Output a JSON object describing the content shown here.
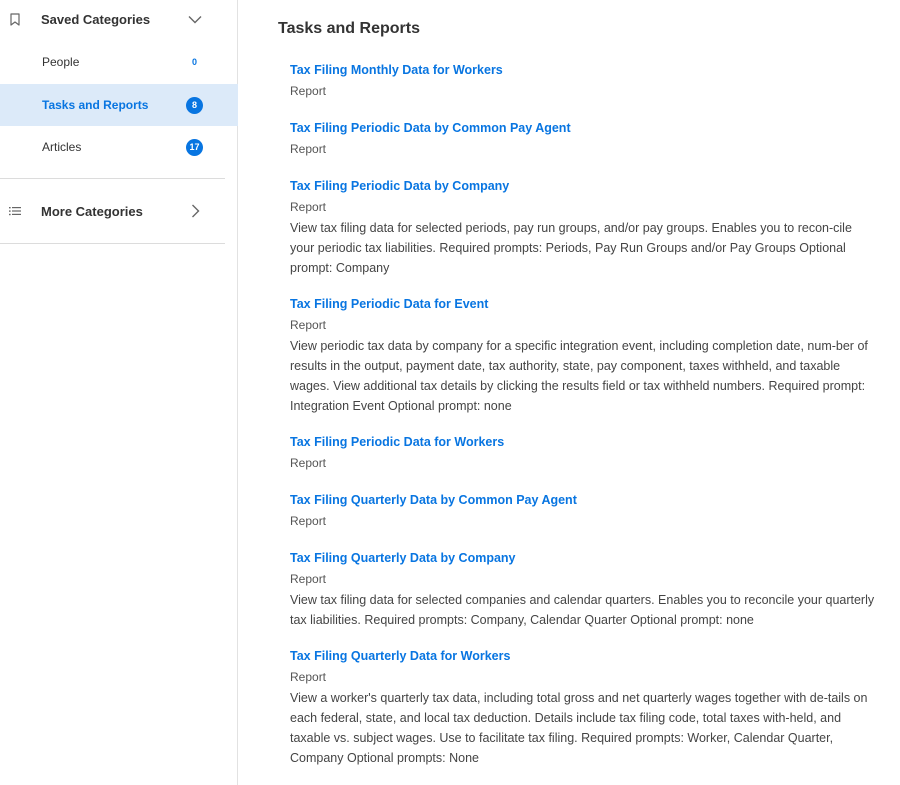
{
  "sidebar": {
    "saved_title": "Saved Categories",
    "saved_icon": "bookmark-icon",
    "saved_toggle_icon": "chevron-down-icon",
    "items": [
      {
        "label": "People",
        "count": "0"
      },
      {
        "label": "Tasks and Reports",
        "count": "8"
      },
      {
        "label": "Articles",
        "count": "17"
      }
    ],
    "more_title": "More Categories",
    "more_icon": "list-icon",
    "more_toggle_icon": "chevron-right-icon"
  },
  "main": {
    "title": "Tasks and Reports",
    "results": [
      {
        "title": "Tax Filing Monthly Data for Workers",
        "type": "Report",
        "desc": ""
      },
      {
        "title": "Tax Filing Periodic Data by Common Pay Agent",
        "type": "Report",
        "desc": ""
      },
      {
        "title": "Tax Filing Periodic Data by Company",
        "type": "Report",
        "desc": "View tax filing data for selected periods, pay run groups, and/or pay groups. Enables you to recon-cile your periodic tax liabilities. Required prompts: Periods, Pay Run Groups and/or Pay Groups Optional prompt: Company"
      },
      {
        "title": "Tax Filing Periodic Data for Event",
        "type": "Report",
        "desc": "View periodic tax data by company for a specific integration event, including completion date, num-ber of results in the output, payment date, tax authority, state, pay component, taxes withheld, and taxable wages. View additional tax details by clicking the results field or tax withheld numbers. Required prompt: Integration Event Optional prompt: none"
      },
      {
        "title": "Tax Filing Periodic Data for Workers",
        "type": "Report",
        "desc": ""
      },
      {
        "title": "Tax Filing Quarterly Data by Common Pay Agent",
        "type": "Report",
        "desc": ""
      },
      {
        "title": "Tax Filing Quarterly Data by Company",
        "type": "Report",
        "desc": "View tax filing data for selected companies and calendar quarters. Enables you to reconcile your quarterly tax liabilities. Required prompts: Company, Calendar Quarter Optional prompt: none"
      },
      {
        "title": "Tax Filing Quarterly Data for Workers",
        "type": "Report",
        "desc": "View a worker's quarterly tax data, including total gross and net quarterly wages together with de-tails on each federal, state, and local tax deduction. Details include tax filing code, total taxes with-held, and taxable vs. subject wages. Use to facilitate tax filing. Required prompts: Worker, Calendar Quarter, Company Optional prompts: None"
      }
    ]
  },
  "colors": {
    "accent": "#0875e1",
    "active_bg": "#dceaf9"
  }
}
